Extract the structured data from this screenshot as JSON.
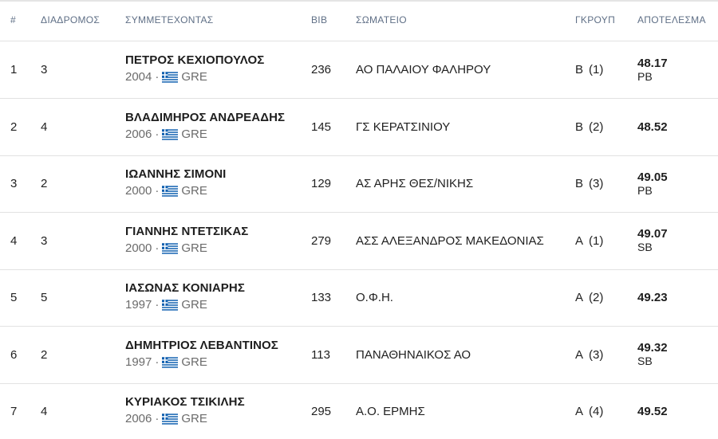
{
  "headers": {
    "rank": "#",
    "lane": "ΔΙΑΔΡΟΜΟΣ",
    "athlete": "ΣΥΜΜΕΤΕΧΟΝΤΑΣ",
    "bib": "BIB",
    "club": "ΣΩΜΑΤΕΙΟ",
    "group": "ΓΚΡΟΥΠ",
    "result": "ΑΠΟΤΕΛΕΣΜΑ"
  },
  "rows": [
    {
      "rank": "1",
      "lane": "3",
      "name": "ΠΕΤΡΟΣ ΚΕΧΙΟΠΟΥΛΟΣ",
      "year": "2004",
      "sep": "·",
      "flag_icon": "greece-flag-icon",
      "country": "GRE",
      "bib": "236",
      "club": "ΑΟ ΠΑΛΑΙΟΥ ΦΑΛΗΡΟΥ",
      "group": "Β",
      "group_pos": "(1)",
      "time": "48.17",
      "note": "PB"
    },
    {
      "rank": "2",
      "lane": "4",
      "name": "ΒΛΑΔΙΜΗΡΟΣ ΑΝΔΡΕΑΔΗΣ",
      "year": "2006",
      "sep": "·",
      "flag_icon": "greece-flag-icon",
      "country": "GRE",
      "bib": "145",
      "club": "ΓΣ ΚΕΡΑΤΣΙΝΙΟΥ",
      "group": "Β",
      "group_pos": "(2)",
      "time": "48.52",
      "note": ""
    },
    {
      "rank": "3",
      "lane": "2",
      "name": "ΙΩΑΝΝΗΣ ΣΙΜΟΝΙ",
      "year": "2000",
      "sep": "·",
      "flag_icon": "greece-flag-icon",
      "country": "GRE",
      "bib": "129",
      "club": "ΑΣ ΑΡΗΣ ΘΕΣ/ΝΙΚΗΣ",
      "group": "Β",
      "group_pos": "(3)",
      "time": "49.05",
      "note": "PB"
    },
    {
      "rank": "4",
      "lane": "3",
      "name": "ΓΙΑΝΝΗΣ ΝΤΕΤΣΙΚΑΣ",
      "year": "2000",
      "sep": "·",
      "flag_icon": "greece-flag-icon",
      "country": "GRE",
      "bib": "279",
      "club": "ΑΣΣ ΑΛΕΞΑΝΔΡΟΣ ΜΑΚΕΔΟΝΙΑΣ",
      "group": "Α",
      "group_pos": "(1)",
      "time": "49.07",
      "note": "SB"
    },
    {
      "rank": "5",
      "lane": "5",
      "name": "ΙΑΣΩΝΑΣ ΚΟΝΙΑΡΗΣ",
      "year": "1997",
      "sep": "·",
      "flag_icon": "greece-flag-icon",
      "country": "GRE",
      "bib": "133",
      "club": "Ο.Φ.Η.",
      "group": "Α",
      "group_pos": "(2)",
      "time": "49.23",
      "note": ""
    },
    {
      "rank": "6",
      "lane": "2",
      "name": "ΔΗΜΗΤΡΙΟΣ ΛΕΒΑΝΤΙΝΟΣ",
      "year": "1997",
      "sep": "·",
      "flag_icon": "greece-flag-icon",
      "country": "GRE",
      "bib": "113",
      "club": "ΠΑΝΑΘΗΝΑΙΚΟΣ ΑΟ",
      "group": "Α",
      "group_pos": "(3)",
      "time": "49.32",
      "note": "SB"
    },
    {
      "rank": "7",
      "lane": "4",
      "name": "ΚΥΡΙΑΚΟΣ ΤΣΙΚΙΛΗΣ",
      "year": "2006",
      "sep": "·",
      "flag_icon": "greece-flag-icon",
      "country": "GRE",
      "bib": "295",
      "club": "Α.Ο. ΕΡΜΗΣ",
      "group": "Α",
      "group_pos": "(4)",
      "time": "49.52",
      "note": ""
    }
  ],
  "colors": {
    "header_text": "#5f6f86",
    "divider": "#e2e2e2",
    "flag_blue": "#0d5eaf",
    "flag_white": "#ffffff"
  }
}
